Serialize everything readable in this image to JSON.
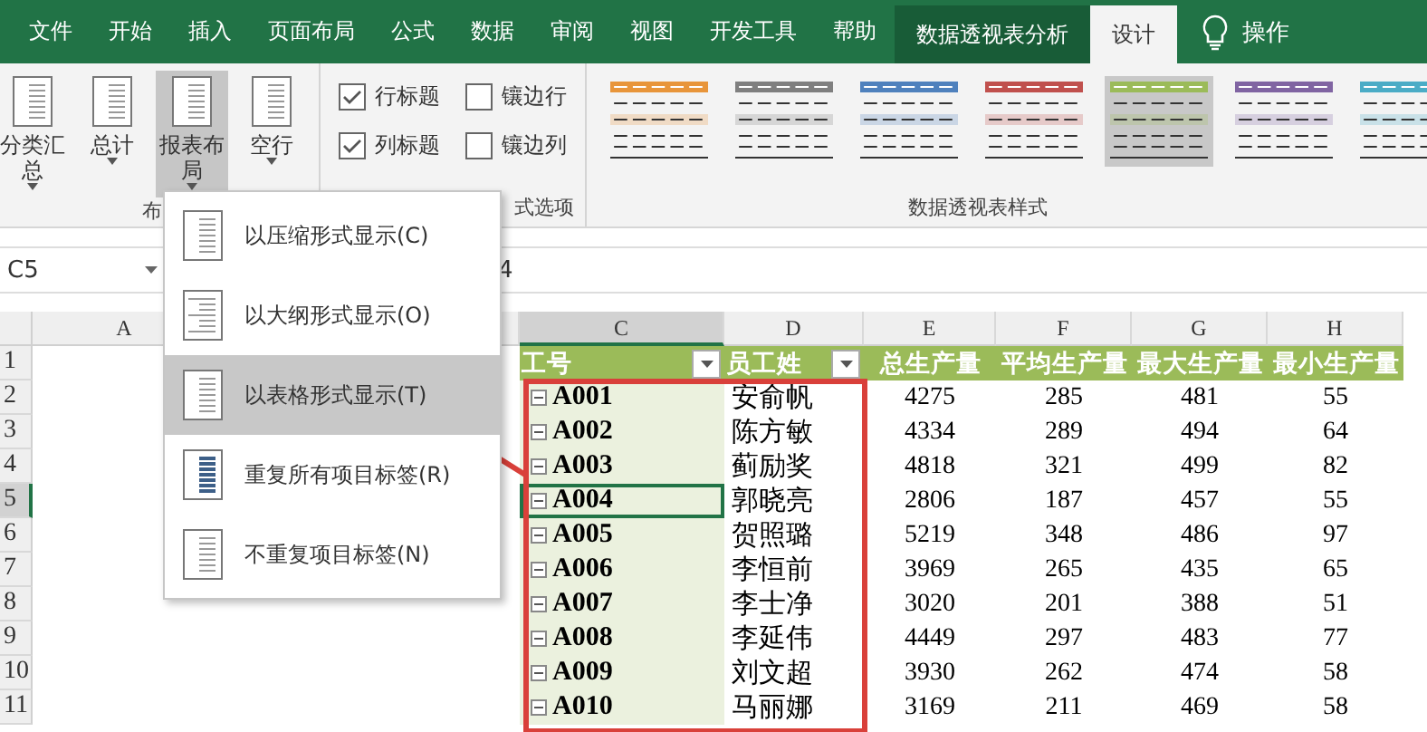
{
  "ribbon_tabs": [
    {
      "label": "文件",
      "selected": false,
      "kind": "tab"
    },
    {
      "label": "开始",
      "selected": false,
      "kind": "tab"
    },
    {
      "label": "插入",
      "selected": false,
      "kind": "tab"
    },
    {
      "label": "页面布局",
      "selected": false,
      "kind": "tab"
    },
    {
      "label": "公式",
      "selected": false,
      "kind": "tab"
    },
    {
      "label": "数据",
      "selected": false,
      "kind": "tab"
    },
    {
      "label": "审阅",
      "selected": false,
      "kind": "tab"
    },
    {
      "label": "视图",
      "selected": false,
      "kind": "tab"
    },
    {
      "label": "开发工具",
      "selected": false,
      "kind": "tab"
    },
    {
      "label": "帮助",
      "selected": false,
      "kind": "tab"
    },
    {
      "label": "数据透视表分析",
      "selected": false,
      "kind": "context"
    },
    {
      "label": "设计",
      "selected": true,
      "kind": "context"
    }
  ],
  "tell_me": "操作",
  "layout_buttons": [
    {
      "label": "分类汇总",
      "pressed": false
    },
    {
      "label": "总计",
      "pressed": false
    },
    {
      "label": "报表布局",
      "pressed": true
    },
    {
      "label": "空行",
      "pressed": false
    }
  ],
  "layout_group_label": "布",
  "options": [
    {
      "label": "行标题",
      "checked": true
    },
    {
      "label": "镶边行",
      "checked": false
    },
    {
      "label": "列标题",
      "checked": true
    },
    {
      "label": "镶边列",
      "checked": false
    }
  ],
  "options_group_label": "式选项",
  "styles": [
    {
      "color": "#e8953a",
      "selected": false
    },
    {
      "color": "#7f7f7f",
      "selected": false
    },
    {
      "color": "#4f81bd",
      "selected": false
    },
    {
      "color": "#c0504d",
      "selected": false
    },
    {
      "color": "#9bbb59",
      "selected": true
    },
    {
      "color": "#8064a2",
      "selected": false
    },
    {
      "color": "#4bacc6",
      "selected": false
    }
  ],
  "styles_group_label": "数据透视表样式",
  "name_box": "C5",
  "formula": "4",
  "columns": [
    "A",
    "C",
    "D",
    "E",
    "F",
    "G",
    "H"
  ],
  "row_numbers": [
    "1",
    "2",
    "3",
    "4",
    "5",
    "6",
    "7",
    "8",
    "9",
    "10",
    "11"
  ],
  "pivot": {
    "headers": [
      {
        "label": "工号",
        "filter": true
      },
      {
        "label": "员工姓",
        "filter": true
      },
      {
        "label": "总生产量",
        "filter": false
      },
      {
        "label": "平均生产量",
        "filter": false
      },
      {
        "label": "最大生产量",
        "filter": false
      },
      {
        "label": "最小生产量",
        "filter": false
      }
    ],
    "rows": [
      {
        "cells": [
          "A001",
          "安俞帆",
          "4275",
          "285",
          "481",
          "55"
        ],
        "selected": false
      },
      {
        "cells": [
          "A002",
          "陈方敏",
          "4334",
          "289",
          "494",
          "64"
        ],
        "selected": false
      },
      {
        "cells": [
          "A003",
          "蓟励奖",
          "4818",
          "321",
          "499",
          "82"
        ],
        "selected": false
      },
      {
        "cells": [
          "A004",
          "郭晓亮",
          "2806",
          "187",
          "457",
          "55"
        ],
        "selected": true
      },
      {
        "cells": [
          "A005",
          "贺照璐",
          "5219",
          "348",
          "486",
          "97"
        ],
        "selected": false
      },
      {
        "cells": [
          "A006",
          "李恒前",
          "3969",
          "265",
          "435",
          "65"
        ],
        "selected": false
      },
      {
        "cells": [
          "A007",
          "李士净",
          "3020",
          "201",
          "388",
          "51"
        ],
        "selected": false
      },
      {
        "cells": [
          "A008",
          "李延伟",
          "4449",
          "297",
          "483",
          "77"
        ],
        "selected": false
      },
      {
        "cells": [
          "A009",
          "刘文超",
          "3930",
          "262",
          "474",
          "58"
        ],
        "selected": false
      },
      {
        "cells": [
          "A010",
          "马丽娜",
          "3169",
          "211",
          "469",
          "58"
        ],
        "selected": false
      }
    ]
  },
  "menu": {
    "items": [
      {
        "label": "以压缩形式显示(C)",
        "selected": false
      },
      {
        "label": "以大纲形式显示(O)",
        "selected": false
      },
      {
        "label": "以表格形式显示(T)",
        "selected": true
      },
      {
        "label": "重复所有项目标签(R)",
        "selected": false
      },
      {
        "label": "不重复项目标签(N)",
        "selected": false
      }
    ]
  }
}
